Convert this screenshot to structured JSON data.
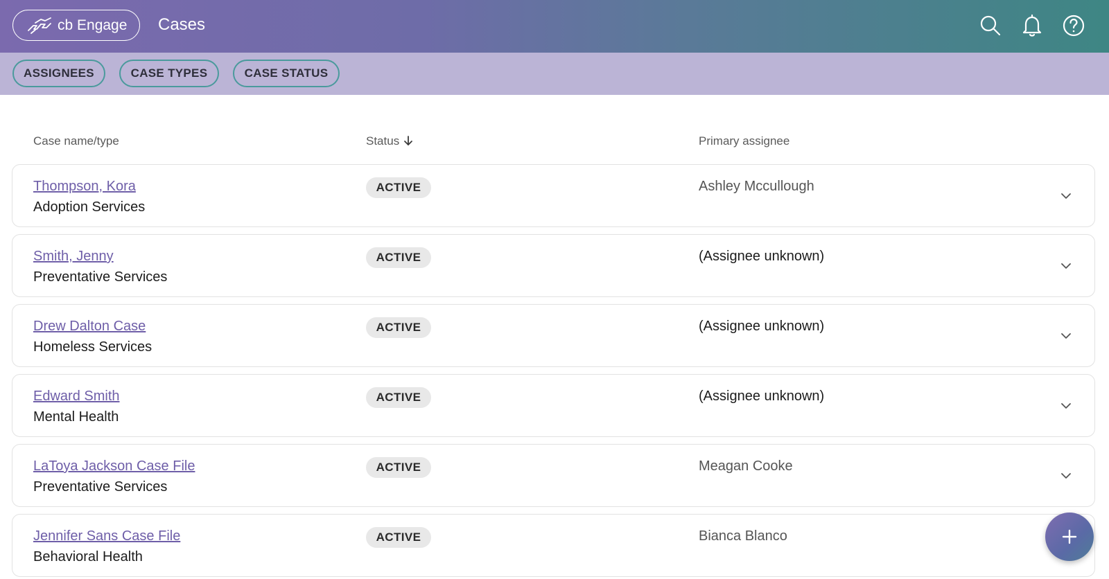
{
  "header": {
    "brand_label": "cb Engage",
    "page_title": "Cases",
    "icons": [
      "search-icon",
      "bell-icon",
      "help-icon"
    ]
  },
  "filters": {
    "chips": [
      {
        "label": "ASSIGNEES"
      },
      {
        "label": "CASE TYPES"
      },
      {
        "label": "CASE STATUS"
      }
    ]
  },
  "table": {
    "columns": {
      "name": "Case name/type",
      "status": "Status",
      "assignee": "Primary assignee"
    },
    "sort": {
      "column": "Status",
      "direction": "descending"
    },
    "rows": [
      {
        "name": "Thompson, Kora",
        "type": "Adoption Services",
        "status": "ACTIVE",
        "assignee": "Ashley Mccullough"
      },
      {
        "name": "Smith, Jenny",
        "type": "Preventative Services",
        "status": "ACTIVE",
        "assignee": "(Assignee unknown)"
      },
      {
        "name": "Drew Dalton Case",
        "type": "Homeless Services",
        "status": "ACTIVE",
        "assignee": "(Assignee unknown)"
      },
      {
        "name": "Edward Smith",
        "type": "Mental Health",
        "status": "ACTIVE",
        "assignee": "(Assignee unknown)"
      },
      {
        "name": "LaToya Jackson Case File",
        "type": "Preventative Services",
        "status": "ACTIVE",
        "assignee": "Meagan Cooke"
      },
      {
        "name": "Jennifer Sans Case File",
        "type": "Behavioral Health",
        "status": "ACTIVE",
        "assignee": "Bianca Blanco"
      }
    ]
  },
  "fab": {
    "icon": "plus-icon"
  },
  "colors": {
    "header_gradient_start": "#7b6aae",
    "header_gradient_end": "#3e8684",
    "subbar": "#bbb4d6",
    "chip_border": "#4a9a9c",
    "link": "#6e5ea8",
    "badge_bg": "#e8e8e8"
  }
}
